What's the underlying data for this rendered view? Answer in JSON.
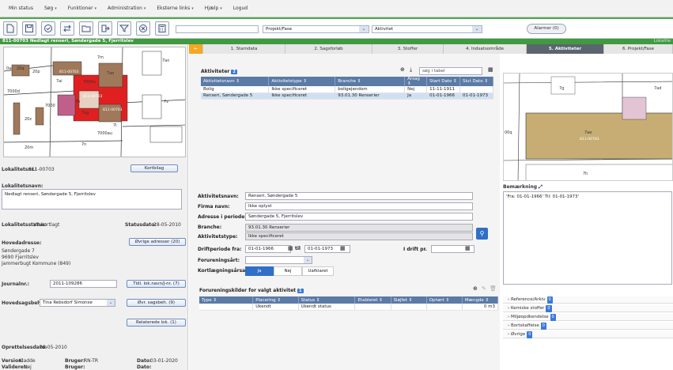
{
  "menu": {
    "items": [
      {
        "label": "Min status",
        "caret": false
      },
      {
        "label": "Søg",
        "caret": true
      },
      {
        "label": "Funktioner",
        "caret": true
      },
      {
        "label": "Administration",
        "caret": true
      },
      {
        "label": "Eksterne links",
        "caret": true
      },
      {
        "label": "Hjælp",
        "caret": true
      },
      {
        "label": "Logud",
        "caret": false
      }
    ]
  },
  "toolbar": {
    "search_value": "",
    "dropdown1": "Projekt/Fase",
    "dropdown2": "Aktivitet",
    "alarm_label": "Alarmer (0)"
  },
  "title": {
    "text": "811-00703 Nedlagt renseri, Søndergade 5, Fjerritslev",
    "right": "Lokalite"
  },
  "map1": {
    "labels": [
      "7m",
      "7an",
      "0ai",
      "20q",
      "20p",
      "811-00703",
      "7ai",
      "7ao",
      "7000d",
      "7000u",
      "7h",
      "7000",
      "20z",
      "7ag",
      "7l",
      "7v",
      "20m",
      "7n",
      "7000au",
      "811-00703",
      "811-00703",
      "811-00703",
      "811-00703"
    ]
  },
  "left": {
    "lokalitetsnr_label": "Lokalitetsnr.:",
    "lokalitetsnr": "811-00703",
    "kortbilag": "Kortbilag",
    "lokalitetsnavn_label": "Lokalitetsnavn:",
    "lokalitetsnavn": "Nedlagt renseri, Søndergade 5, Fjerritslev",
    "status_label": "Lokalitetsstatus:",
    "status": "V2-kortlagt",
    "statusdato_label": "Statusdato:",
    "statusdato": "28-05-2010",
    "hovedadresse_label": "Hovedadresse:",
    "ovrige_adresser": "Øvrige adresser (20)",
    "address1": "Søndergade 7",
    "address2": "9690 Fjerritslev",
    "address3": "Jammerbugt Kommune (849)",
    "journalnr_label": "Journalnr.:",
    "journalnr": "2011-109286",
    "tidl_lok": "Tidl. lok.navn/J-nr. (7)",
    "hovedsagsbeh_label": "Hovedsagsbeh.:",
    "hovedsagsbeh": "Tina Rebsdorf Simonse",
    "ovr_sagsbeh": "Øvr. sagsbeh. (9)",
    "relaterede": "Relaterede lok. (1)",
    "oprettelsesdato_label": "Oprettelsesdato:",
    "oprettelsesdato": "28-05-2010",
    "version_label": "Version:",
    "version": "Kladde",
    "bruger1_label": "Bruger:",
    "bruger1": "RN-TR",
    "dato1_label": "Dato:",
    "dato1": "03-01-2020",
    "valideret_label": "Valideret:",
    "valideret": "Nej",
    "bruger2_label": "Bruger:",
    "bruger2": "",
    "dato2_label": "Dato:",
    "dato2": ""
  },
  "tabs": [
    "1. Stamdata",
    "2. Sagsforløb",
    "3. Stoffer",
    "4. Indsatsområde",
    "5. Aktiviteter",
    "6. Projekt/Fase"
  ],
  "activities": {
    "title": "Aktiviteter",
    "count": "2",
    "search_placeholder": "søg i tabel",
    "columns": [
      "Aktivitetsnavn ⇕",
      "Aktivitetstype ⇕",
      "Branche ⇕",
      "Årsag ⇕",
      "Start Dato ⇕",
      "Slut Dato ⇕"
    ],
    "rows": [
      [
        "Bolig",
        "Ikke specificeret",
        "boligejendom",
        "Nej",
        "11-11-1911",
        ""
      ],
      [
        "Renseri, Søndergade 5",
        "Ikke specificeret",
        "93.01.30 Renserier",
        "Ja",
        "01-01-1966",
        "01-01-1973"
      ]
    ]
  },
  "form": {
    "aktivitetsnavn_label": "Aktivitetsnavn:",
    "aktivitetsnavn": "Renseri, Søndergade 5",
    "firmanavn_label": "Firma navn:",
    "firmanavn": "Ikke oplyst",
    "adresse_label": "Adresse i periode:",
    "adresse": "Søndergade 5, Fjerritslev",
    "branche_label": "Branche:",
    "branche": "93.01.30 Renserier",
    "aktivitetstype_label": "Aktivitetstype:",
    "aktivitetstype": "Ikke specificeret",
    "driftperiode_label": "Driftperiode fra:",
    "fra": "01-01-1966",
    "til_label": "til",
    "til": "01-01-1973",
    "idrift_label": "I drift pr.",
    "idrift": "",
    "forureningsart_label": "Forureningsårt:",
    "kortlaegning_label": "Kortlægningsårsag?",
    "ja": "Ja",
    "nej": "Nej",
    "uafklaret": "Uafklaret"
  },
  "sources": {
    "title": "Forureningskilder for valgt aktivitet",
    "count": "1",
    "columns": [
      "Type ⇕",
      "Placering ⇕",
      "Status ⇕",
      "Etableret ⇕",
      "Sløjfet ⇕",
      "Ophørt ⇕",
      "Mængde ⇕"
    ],
    "rows": [
      [
        "",
        "Ukendt",
        "Ukendt status",
        "",
        "",
        "",
        "0 m3"
      ]
    ]
  },
  "right": {
    "bemaerkning_label": "Bemærkning",
    "bemaerkning": "'Fra: 01-01-1966' Til: 01-01-1973'",
    "map2_labels": [
      "7g",
      "7ad",
      "7ae",
      "811-00703",
      "7h",
      "00q"
    ],
    "accordion": [
      {
        "label": "Reference/Arkiv",
        "count": "0"
      },
      {
        "label": "Kemiske stoffer",
        "count": "0"
      },
      {
        "label": "Miljøopdkendelse",
        "count": "0"
      },
      {
        "label": "Bortskaffelse",
        "count": "0"
      },
      {
        "label": "Øvrige",
        "count": "0"
      }
    ]
  },
  "colors": {
    "green": "#3f9b3f",
    "tab_active": "#5a6570",
    "grid_header": "#5b7aa6",
    "accent": "#3c78d8"
  }
}
